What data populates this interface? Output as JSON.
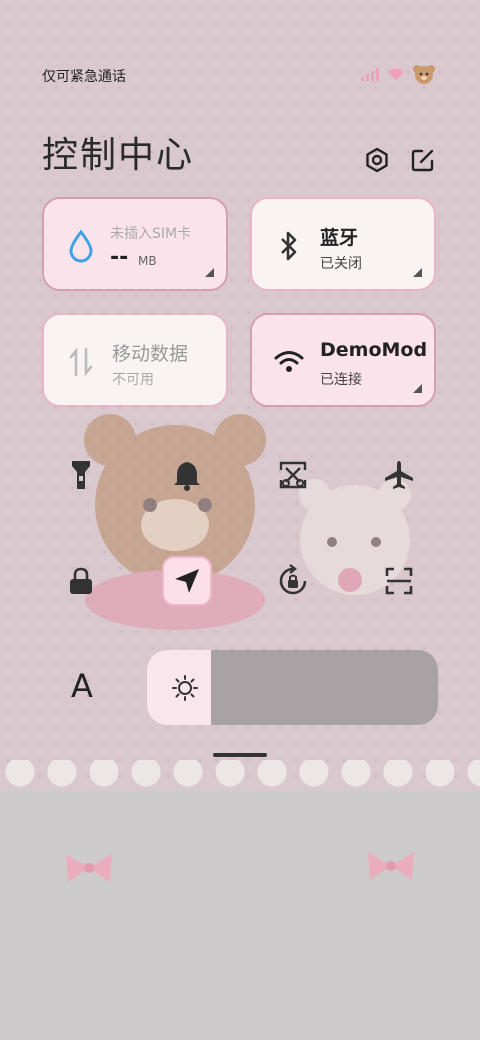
{
  "status_bar": {
    "carrier_text": "仅可紧急通话",
    "icons": [
      "signal-icon",
      "wifi-icon",
      "bear-icon"
    ]
  },
  "header": {
    "title": "控制中心",
    "settings_icon": "settings-icon",
    "edit_icon": "edit-icon"
  },
  "tiles": {
    "data_usage": {
      "main": "--",
      "unit": "MB",
      "sub": "未插入SIM卡"
    },
    "bluetooth": {
      "main": "蓝牙",
      "sub": "已关闭"
    },
    "mobile_data": {
      "main": "移动数据",
      "sub": "不可用"
    },
    "wifi": {
      "main": "DemoMod",
      "sub": "已连接"
    }
  },
  "quick_toggles": [
    {
      "name": "flashlight-icon",
      "active": false
    },
    {
      "name": "bell-icon",
      "active": false
    },
    {
      "name": "screenshot-icon",
      "active": false
    },
    {
      "name": "airplane-icon",
      "active": false
    },
    {
      "name": "lock-icon",
      "active": false
    },
    {
      "name": "location-icon",
      "active": true
    },
    {
      "name": "rotation-lock-icon",
      "active": false
    },
    {
      "name": "scan-icon",
      "active": false
    }
  ],
  "font_button": {
    "label": "A"
  },
  "brightness": {
    "level": 0.22
  },
  "colors": {
    "tile_pink": "#fbe3ec",
    "tile_white": "#f9f3f4",
    "border_pink": "#e8b5c6",
    "slider_track": "#a9a2a4"
  }
}
